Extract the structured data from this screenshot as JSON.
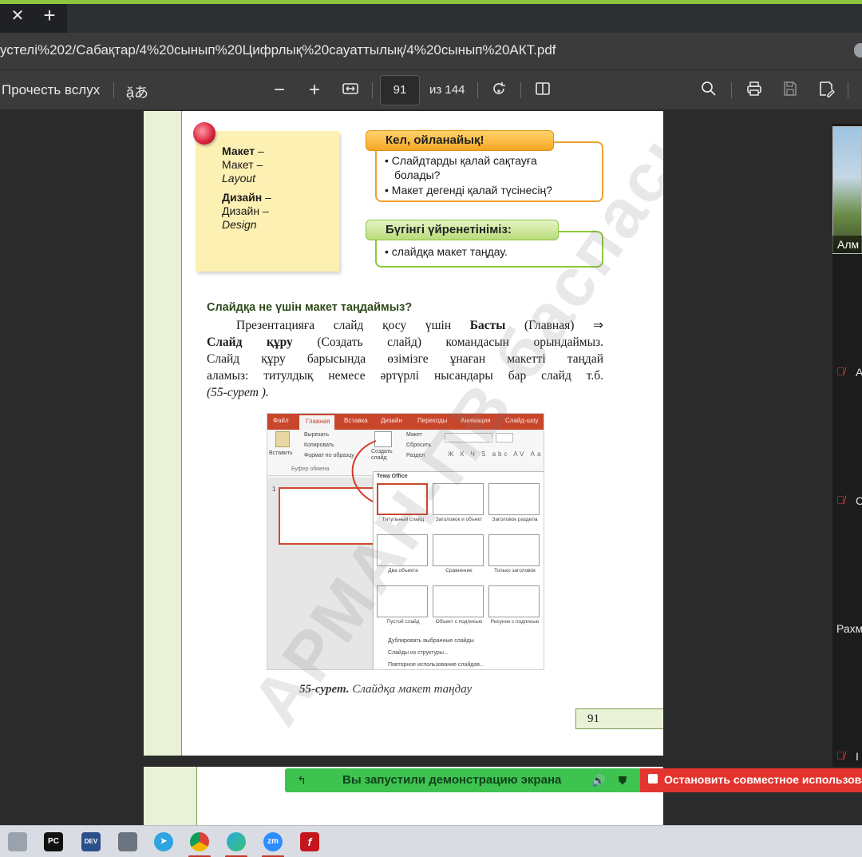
{
  "browser": {
    "tab_close": "✕",
    "tab_new": "+",
    "address": "устелі%202/Сабақтар/4%20сынып%20Цифрлық%20сауаттылық/4%20сынып%20АКТ.pdf"
  },
  "pdf_toolbar": {
    "read_aloud": "Прочесть вслух",
    "translate_glyph": "ặあ",
    "zoom_out": "−",
    "zoom_in": "+",
    "current_page": "91",
    "total_pages": "из 144"
  },
  "page": {
    "note": {
      "term1": "Макет",
      "term1_dash": " –",
      "term1_ru": "Макет –",
      "term1_en": "Layout",
      "term2": "Дизайн",
      "term2_dash": " –",
      "term2_ru": "Дизайн –",
      "term2_en": "Design"
    },
    "think_box": {
      "title": "Кел, ойланайық!",
      "items": [
        "• Слайдтарды қалай сақтауға",
        "болады?",
        "• Макет дегенді қалай түсінесің?"
      ]
    },
    "learn_box": {
      "title": "Бүгінгі үйренетініміз:",
      "items": [
        "• слайдқа макет таңдау."
      ]
    },
    "section_title": "Слайдқа не үшін макет таңдаймыз?",
    "body": {
      "l1_a": "Презентацияға слайд қосу үшін ",
      "l1_b": "Басты",
      "l1_c": " (Главная) ⇒",
      "l2_a": "Слайд құру",
      "l2_b": " (Создать слайд) командасын орындаймыз.",
      "l3": "Слайд құру барысында өзімізге ұнаған макетті таңдай",
      "l4": "аламыз: титулдық немесе әртүрлі нысандары бар слайд т.б.",
      "l5": "(55-сурет )."
    },
    "figure": {
      "tabs": [
        "Файл",
        "Главная",
        "Вставка",
        "Дизайн",
        "Переходы",
        "Анимация",
        "Слайд-шоу"
      ],
      "clipboard": [
        "Вырезать",
        "Копировать",
        "Формат по образцу"
      ],
      "insert_label": "Вставить",
      "clipboard_group": "Буфер обмена",
      "new_slide": "Создать слайд",
      "slide_cmds": [
        "Макет",
        "Сбросить",
        "Раздел"
      ],
      "theme_label": "Тема Office",
      "slide_number": "1",
      "layouts": [
        "Титульный слайд",
        "Заголовок и объект",
        "Заголовок раздела",
        "Два объекта",
        "Сравнение",
        "Только заголовок",
        "Пустой слайд",
        "Объект с подписью",
        "Рисунок с подписью"
      ],
      "menu": [
        "Дублировать выбранные слайды",
        "Слайды из структуры...",
        "Повторное использование слайдов..."
      ]
    },
    "caption_num": "55-сурет.",
    "caption_text": " Слайдқа макет таңдау",
    "page_number": "91",
    "watermark": "АРМАН-ПВ баспасы"
  },
  "participants": {
    "video_name": "Алм",
    "p1_initial": "А",
    "p2_initial": "С",
    "p3_name": "Рахм",
    "p4_initial": "I"
  },
  "screen_share": {
    "status": "Вы запустили демонстрацию экрана",
    "stop": "Остановить совместное использование"
  },
  "taskbar": {
    "apps": [
      "PC",
      "DEV",
      "zm"
    ]
  }
}
